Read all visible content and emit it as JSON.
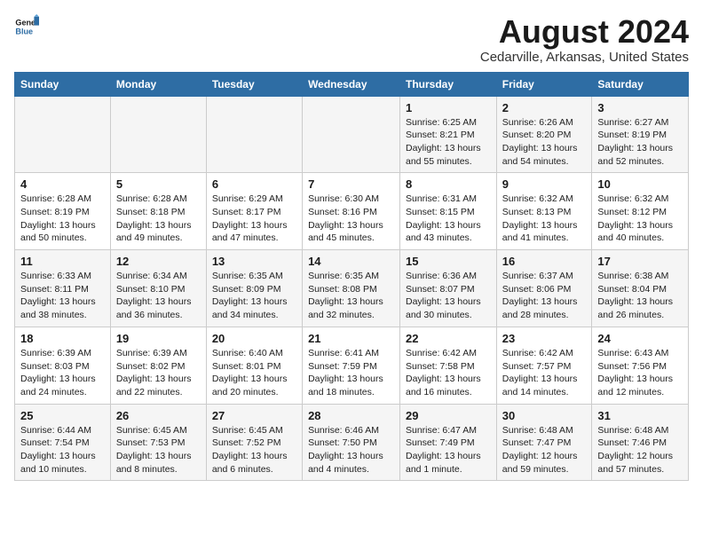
{
  "logo": {
    "text_general": "General",
    "text_blue": "Blue"
  },
  "title": "August 2024",
  "subtitle": "Cedarville, Arkansas, United States",
  "headers": [
    "Sunday",
    "Monday",
    "Tuesday",
    "Wednesday",
    "Thursday",
    "Friday",
    "Saturday"
  ],
  "rows": [
    [
      {
        "date": "",
        "info": ""
      },
      {
        "date": "",
        "info": ""
      },
      {
        "date": "",
        "info": ""
      },
      {
        "date": "",
        "info": ""
      },
      {
        "date": "1",
        "info": "Sunrise: 6:25 AM\nSunset: 8:21 PM\nDaylight: 13 hours\nand 55 minutes."
      },
      {
        "date": "2",
        "info": "Sunrise: 6:26 AM\nSunset: 8:20 PM\nDaylight: 13 hours\nand 54 minutes."
      },
      {
        "date": "3",
        "info": "Sunrise: 6:27 AM\nSunset: 8:19 PM\nDaylight: 13 hours\nand 52 minutes."
      }
    ],
    [
      {
        "date": "4",
        "info": "Sunrise: 6:28 AM\nSunset: 8:19 PM\nDaylight: 13 hours\nand 50 minutes."
      },
      {
        "date": "5",
        "info": "Sunrise: 6:28 AM\nSunset: 8:18 PM\nDaylight: 13 hours\nand 49 minutes."
      },
      {
        "date": "6",
        "info": "Sunrise: 6:29 AM\nSunset: 8:17 PM\nDaylight: 13 hours\nand 47 minutes."
      },
      {
        "date": "7",
        "info": "Sunrise: 6:30 AM\nSunset: 8:16 PM\nDaylight: 13 hours\nand 45 minutes."
      },
      {
        "date": "8",
        "info": "Sunrise: 6:31 AM\nSunset: 8:15 PM\nDaylight: 13 hours\nand 43 minutes."
      },
      {
        "date": "9",
        "info": "Sunrise: 6:32 AM\nSunset: 8:13 PM\nDaylight: 13 hours\nand 41 minutes."
      },
      {
        "date": "10",
        "info": "Sunrise: 6:32 AM\nSunset: 8:12 PM\nDaylight: 13 hours\nand 40 minutes."
      }
    ],
    [
      {
        "date": "11",
        "info": "Sunrise: 6:33 AM\nSunset: 8:11 PM\nDaylight: 13 hours\nand 38 minutes."
      },
      {
        "date": "12",
        "info": "Sunrise: 6:34 AM\nSunset: 8:10 PM\nDaylight: 13 hours\nand 36 minutes."
      },
      {
        "date": "13",
        "info": "Sunrise: 6:35 AM\nSunset: 8:09 PM\nDaylight: 13 hours\nand 34 minutes."
      },
      {
        "date": "14",
        "info": "Sunrise: 6:35 AM\nSunset: 8:08 PM\nDaylight: 13 hours\nand 32 minutes."
      },
      {
        "date": "15",
        "info": "Sunrise: 6:36 AM\nSunset: 8:07 PM\nDaylight: 13 hours\nand 30 minutes."
      },
      {
        "date": "16",
        "info": "Sunrise: 6:37 AM\nSunset: 8:06 PM\nDaylight: 13 hours\nand 28 minutes."
      },
      {
        "date": "17",
        "info": "Sunrise: 6:38 AM\nSunset: 8:04 PM\nDaylight: 13 hours\nand 26 minutes."
      }
    ],
    [
      {
        "date": "18",
        "info": "Sunrise: 6:39 AM\nSunset: 8:03 PM\nDaylight: 13 hours\nand 24 minutes."
      },
      {
        "date": "19",
        "info": "Sunrise: 6:39 AM\nSunset: 8:02 PM\nDaylight: 13 hours\nand 22 minutes."
      },
      {
        "date": "20",
        "info": "Sunrise: 6:40 AM\nSunset: 8:01 PM\nDaylight: 13 hours\nand 20 minutes."
      },
      {
        "date": "21",
        "info": "Sunrise: 6:41 AM\nSunset: 7:59 PM\nDaylight: 13 hours\nand 18 minutes."
      },
      {
        "date": "22",
        "info": "Sunrise: 6:42 AM\nSunset: 7:58 PM\nDaylight: 13 hours\nand 16 minutes."
      },
      {
        "date": "23",
        "info": "Sunrise: 6:42 AM\nSunset: 7:57 PM\nDaylight: 13 hours\nand 14 minutes."
      },
      {
        "date": "24",
        "info": "Sunrise: 6:43 AM\nSunset: 7:56 PM\nDaylight: 13 hours\nand 12 minutes."
      }
    ],
    [
      {
        "date": "25",
        "info": "Sunrise: 6:44 AM\nSunset: 7:54 PM\nDaylight: 13 hours\nand 10 minutes."
      },
      {
        "date": "26",
        "info": "Sunrise: 6:45 AM\nSunset: 7:53 PM\nDaylight: 13 hours\nand 8 minutes."
      },
      {
        "date": "27",
        "info": "Sunrise: 6:45 AM\nSunset: 7:52 PM\nDaylight: 13 hours\nand 6 minutes."
      },
      {
        "date": "28",
        "info": "Sunrise: 6:46 AM\nSunset: 7:50 PM\nDaylight: 13 hours\nand 4 minutes."
      },
      {
        "date": "29",
        "info": "Sunrise: 6:47 AM\nSunset: 7:49 PM\nDaylight: 13 hours\nand 1 minute."
      },
      {
        "date": "30",
        "info": "Sunrise: 6:48 AM\nSunset: 7:47 PM\nDaylight: 12 hours\nand 59 minutes."
      },
      {
        "date": "31",
        "info": "Sunrise: 6:48 AM\nSunset: 7:46 PM\nDaylight: 12 hours\nand 57 minutes."
      }
    ]
  ]
}
